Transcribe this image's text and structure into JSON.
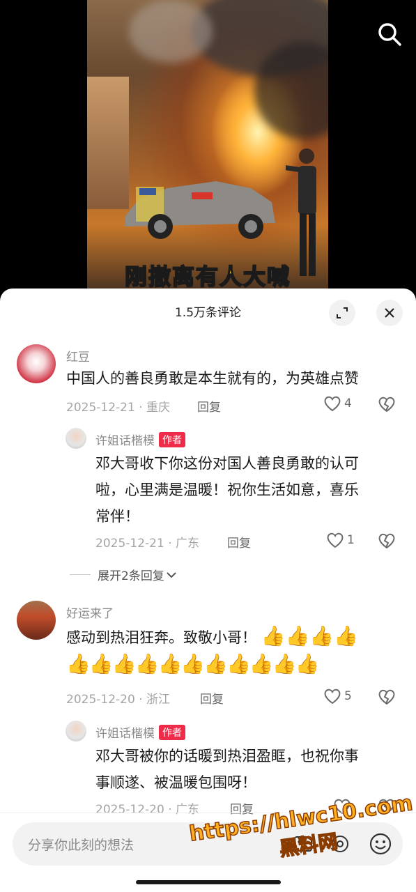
{
  "video": {
    "caption": "刚撤离有人大喊",
    "search_icon": "search-icon"
  },
  "sheet": {
    "title": "1.5万条评论",
    "expand_icon": "expand-icon",
    "close_icon": "close-icon"
  },
  "comments": [
    {
      "user": "红豆",
      "text": "中国人的善良勇敢是本生就有的，为英雄点赞",
      "date": "2025-12-21",
      "location": "重庆",
      "reply_label": "回复",
      "likes": "4"
    },
    {
      "user": "许姐话楷模",
      "badge": "作者",
      "text_lines": [
        "邓大哥收下你这份对国人善良勇敢的认可",
        "啦，心里满是温暖！祝你生活如意，喜乐",
        "常伴！"
      ],
      "date": "2025-12-21",
      "location": "广东",
      "reply_label": "回复",
      "likes": "1"
    },
    {
      "expand_label": "展开2条回复"
    },
    {
      "user": "好运来了",
      "text": "感动到热泪狂奔。致敬小哥！",
      "emoji_thumbs_count": 15,
      "date": "2025-12-20",
      "location": "浙江",
      "reply_label": "回复",
      "likes": "5"
    },
    {
      "user": "许姐话楷模",
      "badge": "作者",
      "text_lines": [
        "邓大哥被你的话暖到热泪盈眶，也祝你事",
        "事顺遂、被温暖包围呀！"
      ],
      "date": "2025-12-20",
      "location": "广东",
      "reply_label": "回复"
    }
  ],
  "input": {
    "placeholder": "分享你此刻的想法"
  },
  "watermark": {
    "url": "https://hlwc10.com",
    "cn": "黑料网"
  },
  "colors": {
    "author_badge": "#ee2c4a",
    "caption": "#ffd92e",
    "watermark": "#ffaf1f"
  }
}
